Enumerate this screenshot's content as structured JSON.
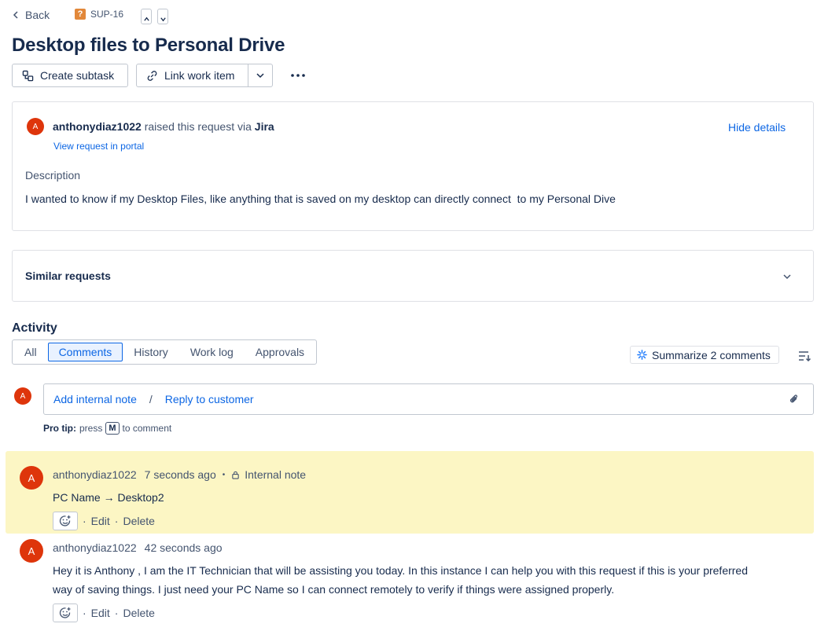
{
  "nav": {
    "back_label": "Back",
    "issue_key": "SUP-16",
    "issue_icon": "?"
  },
  "title": "Desktop files to Personal Drive",
  "toolbar": {
    "create_subtask": "Create subtask",
    "link_work_item": "Link work item"
  },
  "request": {
    "avatar_initial": "A",
    "reporter": "anthonydiaz1022",
    "raised_text": "raised this request via",
    "channel": "Jira",
    "portal_link": "View request in portal",
    "hide_details": "Hide details",
    "description_label": "Description",
    "description": "I wanted to know if my Desktop Files, like anything that is saved on my desktop can directly connect  to my Personal Dive"
  },
  "similar": {
    "label": "Similar requests"
  },
  "activity": {
    "heading": "Activity",
    "tabs": [
      "All",
      "Comments",
      "History",
      "Work log",
      "Approvals"
    ],
    "active_tab": "Comments",
    "summarize": "Summarize 2 comments",
    "editor": {
      "avatar_initial": "A",
      "internal_note": "Add internal note",
      "separator": "/",
      "reply": "Reply to customer"
    },
    "protip": {
      "label": "Pro tip:",
      "press": "press",
      "key": "M",
      "suffix": "to comment"
    }
  },
  "comments": [
    {
      "avatar_initial": "A",
      "author": "anthonydiaz1022",
      "time": "7 seconds ago",
      "bullet": "•",
      "visibility": "Internal note",
      "body": "PC Name → Desktop2",
      "edit": "Edit",
      "delete": "Delete",
      "dot": "·"
    },
    {
      "avatar_initial": "A",
      "author": "anthonydiaz1022",
      "time": "42 seconds ago",
      "body_line1": "Hey it is Anthony , I am the IT Technician that will be assisting you today. In this instance I can help you with this request if this is your preferred",
      "body_line2": "way of saving things. I just need your PC Name so I can connect remotely to verify if things were assigned properly.",
      "edit": "Edit",
      "delete": "Delete",
      "dot": "·"
    }
  ],
  "colors": {
    "accent": "#0c66e4",
    "avatar": "#de350b",
    "internal_note_bg": "#fcf6c4",
    "issue_icon": "#e2883a"
  }
}
